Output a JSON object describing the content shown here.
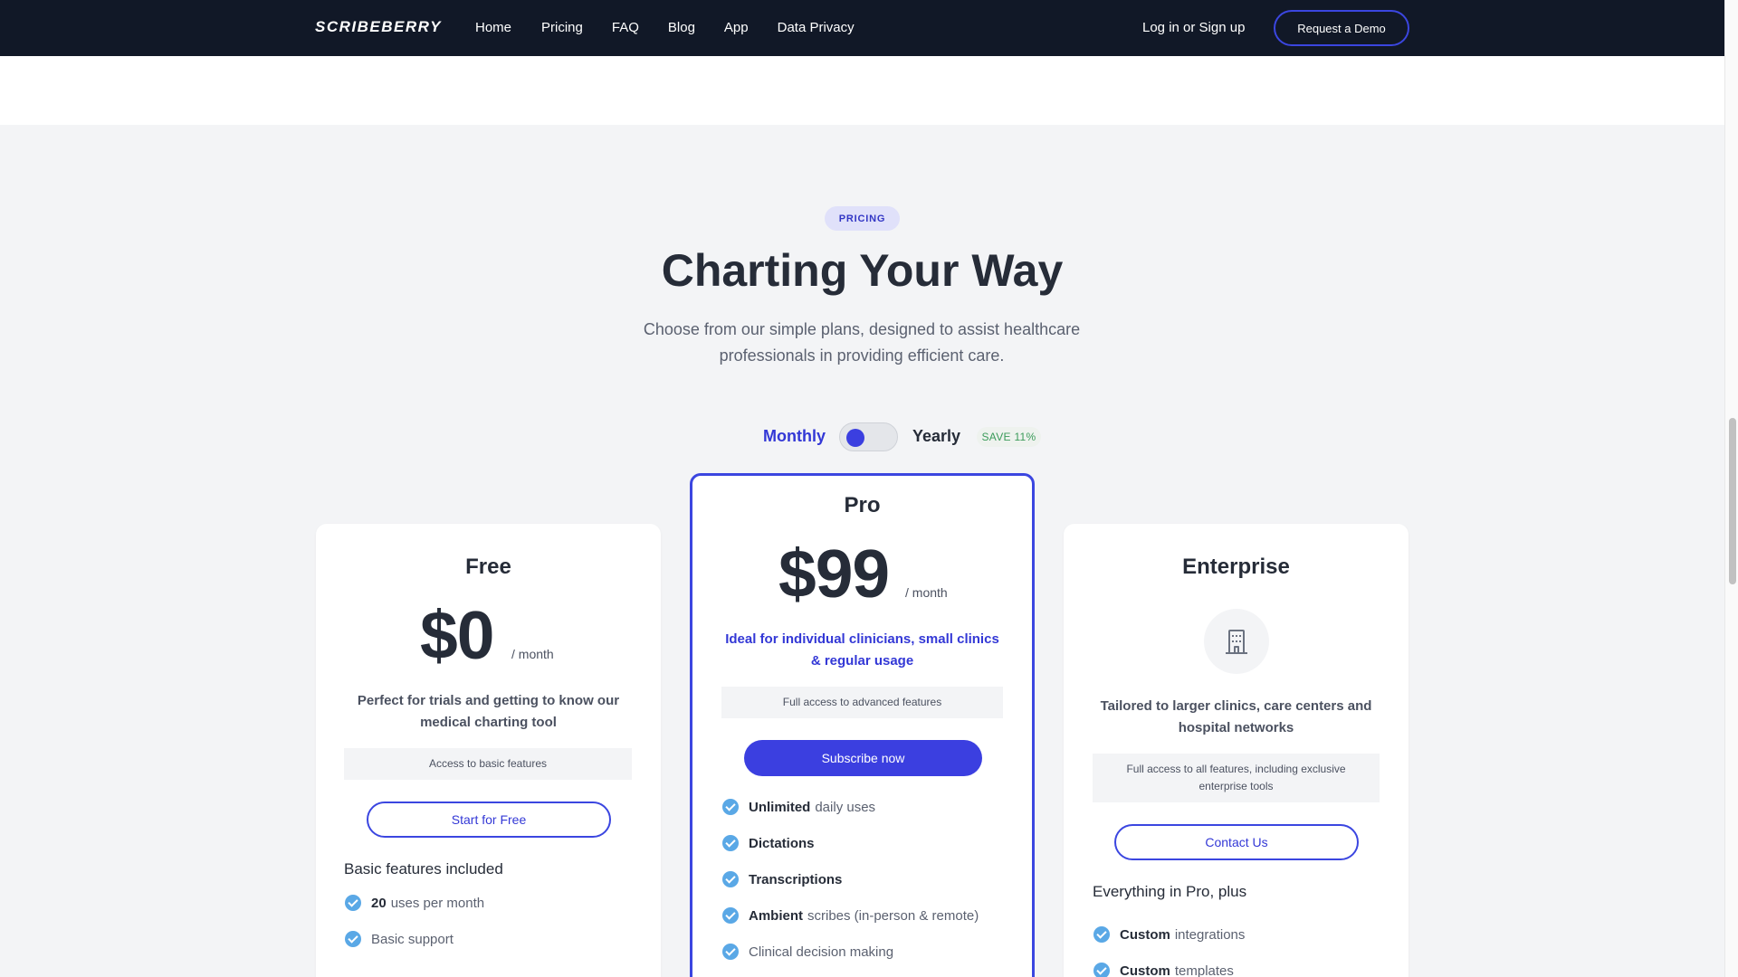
{
  "nav": {
    "logo": "SCRIBEBERRY",
    "links": [
      "Home",
      "Pricing",
      "FAQ",
      "Blog",
      "App",
      "Data Privacy"
    ],
    "login": "Log in or Sign up",
    "demo": "Request a Demo"
  },
  "header": {
    "pill": "PRICING",
    "title": "Charting Your Way",
    "subtitle": "Choose from our simple plans, designed to assist healthcare professionals in providing efficient care."
  },
  "billing": {
    "monthly": "Monthly",
    "yearly": "Yearly",
    "save": "SAVE 11%",
    "selected": "Monthly"
  },
  "plans": {
    "free": {
      "name": "Free",
      "price": "$0",
      "per": "/ month",
      "desc": "Perfect for trials and getting to know our medical charting tool",
      "access": "Access to basic features",
      "cta": "Start for Free",
      "features_head": "Basic features included",
      "features": [
        {
          "bold": "20",
          "rest": "uses per month"
        },
        {
          "bold": "",
          "rest": "Basic support"
        }
      ]
    },
    "pro": {
      "name": "Pro",
      "price": "$99",
      "per": "/ month",
      "desc": "Ideal for individual clinicians, small clinics & regular usage",
      "access": "Full access to advanced features",
      "cta": "Subscribe now",
      "features": [
        {
          "bold": "Unlimited",
          "rest": "daily uses"
        },
        {
          "bold": "Dictations",
          "rest": ""
        },
        {
          "bold": "Transcriptions",
          "rest": ""
        },
        {
          "bold": "Ambient",
          "rest": "scribes (in-person & remote)"
        },
        {
          "bold": "",
          "rest": "Clinical decision making"
        }
      ]
    },
    "enterprise": {
      "name": "Enterprise",
      "icon": "building-icon",
      "desc": "Tailored to larger clinics, care centers and hospital networks",
      "access": "Full access to all features, including exclusive enterprise tools",
      "cta": "Contact Us",
      "features_head": "Everything in Pro, plus",
      "features": [
        {
          "bold": "Custom",
          "rest": "integrations"
        },
        {
          "bold": "Custom",
          "rest": "templates"
        }
      ]
    }
  },
  "colors": {
    "nav_bg": "#111827",
    "accent": "#3b3fe0",
    "check": "#5aa8e6",
    "page_bg": "#f3f4f6"
  }
}
